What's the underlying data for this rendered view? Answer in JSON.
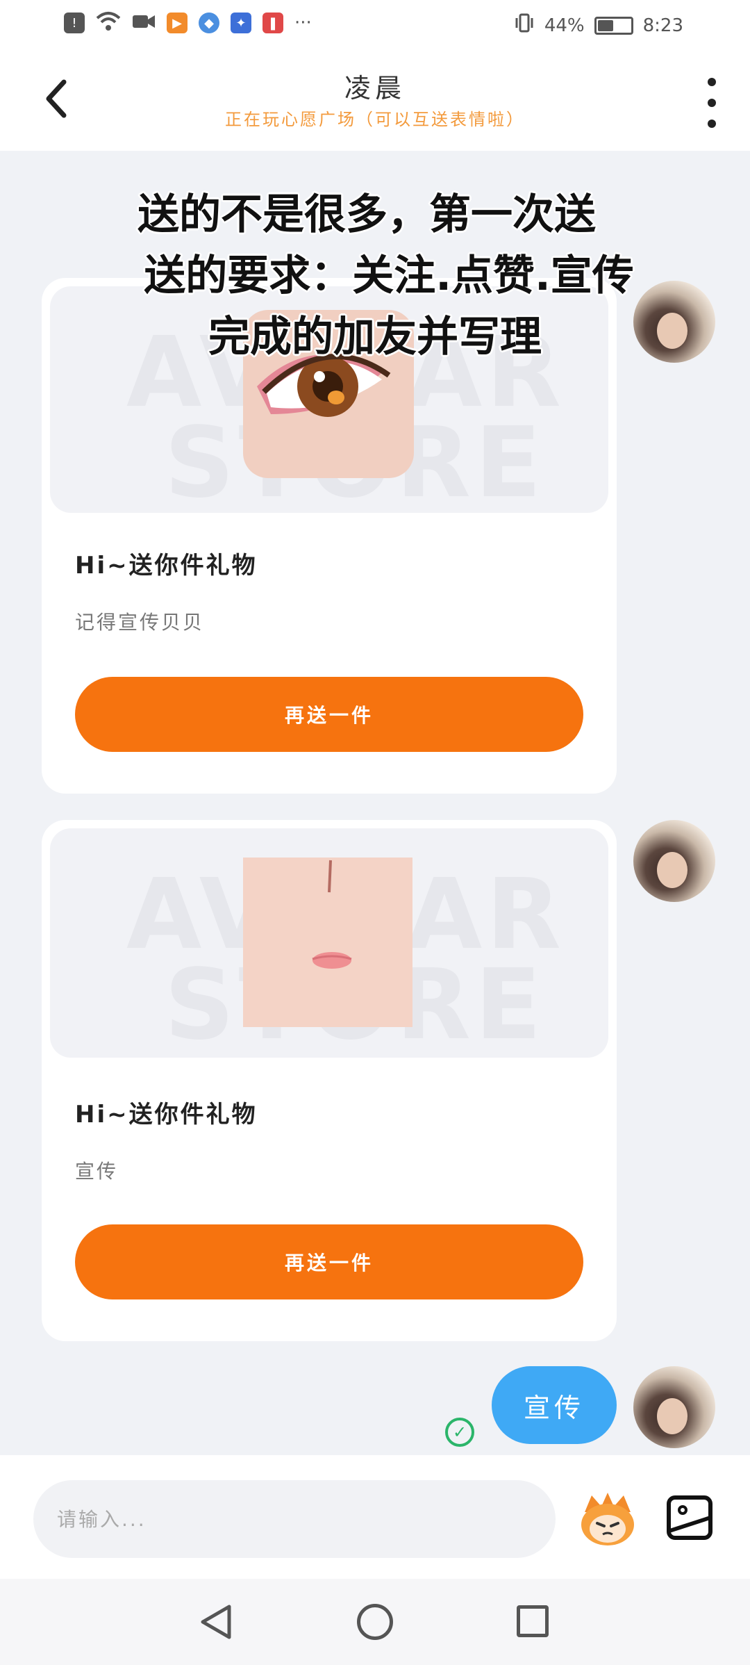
{
  "status_bar": {
    "battery_percent": "44%",
    "time": "8:23",
    "more_indicator": "···",
    "battery_level": 0.44
  },
  "header": {
    "title": "凌晨",
    "subtitle": "正在玩心愿广场（可以互送表情啦）"
  },
  "caption": {
    "line1": "送的不是很多，第一次送",
    "line2": "送的要求：关注.点赞.宣传",
    "line3": "完成的加友并写理"
  },
  "cards": [
    {
      "gift_name": "Hi~送你件礼物",
      "message": "记得宣传贝贝",
      "button_label": "再送一件",
      "watermark": "AVATAR STORE"
    },
    {
      "gift_name": "Hi~送你件礼物",
      "message": "宣传",
      "button_label": "再送一件",
      "watermark": "AVATAR STORE"
    }
  ],
  "message": {
    "text": "宣传",
    "status_icon": "check-circle-icon"
  },
  "input": {
    "placeholder": "请输入..."
  },
  "colors": {
    "accent_orange": "#f6730f",
    "bubble_blue": "#3fa9f5",
    "subtitle_orange": "#f39a3c",
    "check_green": "#2bb56a"
  }
}
